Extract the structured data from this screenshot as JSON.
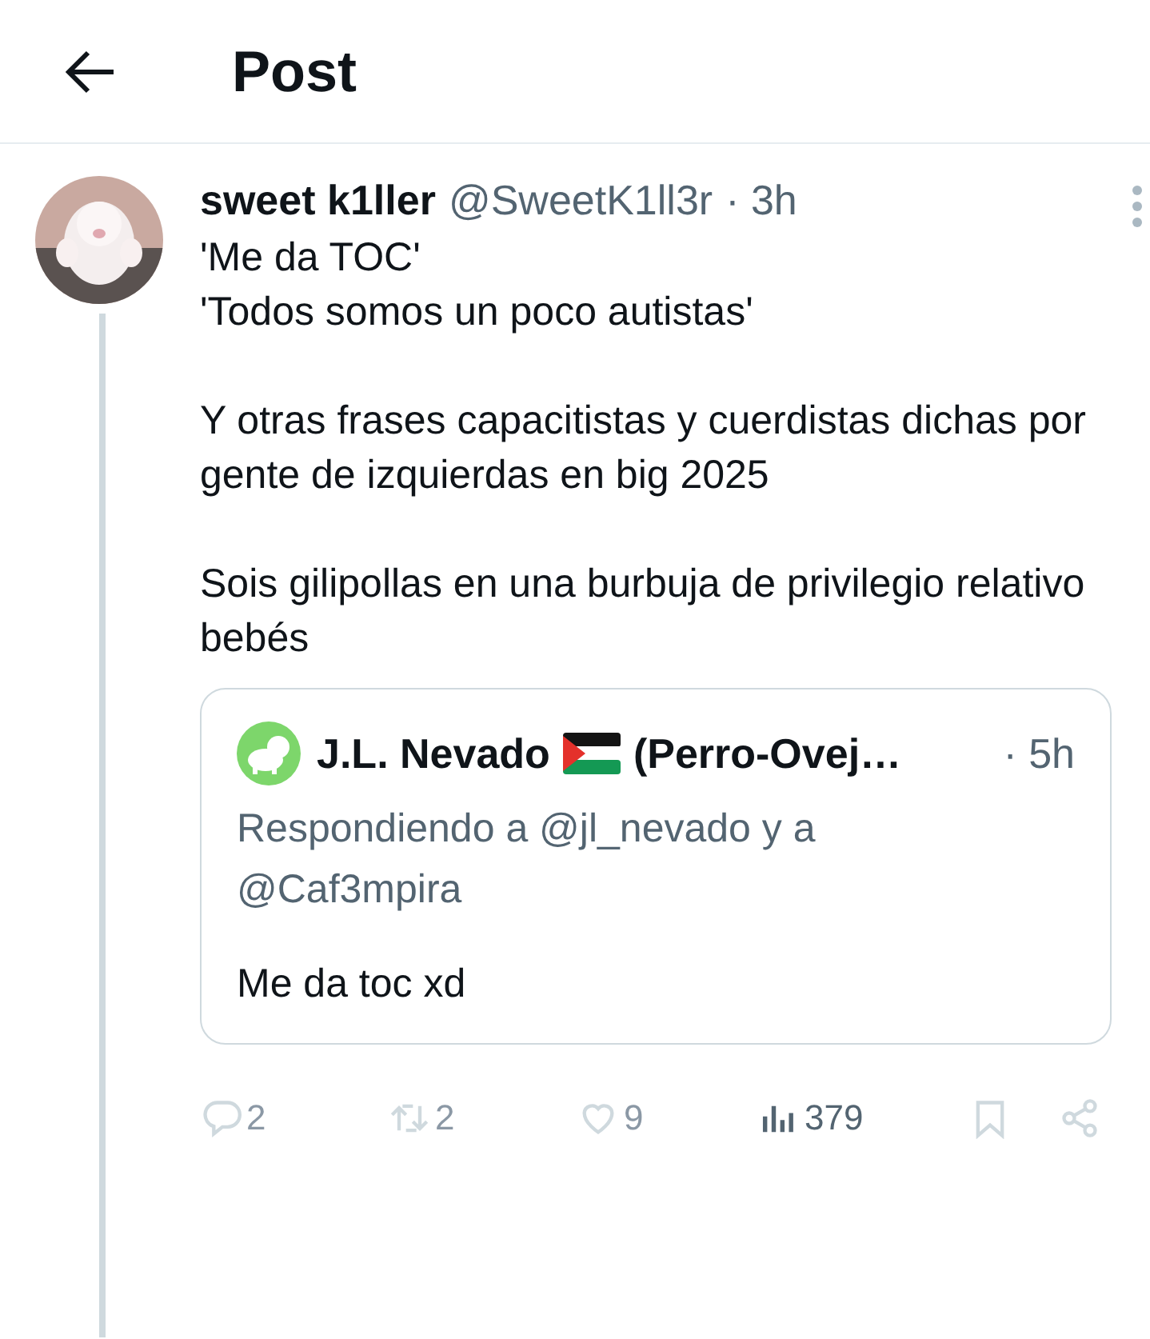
{
  "header": {
    "title": "Post"
  },
  "post": {
    "author_name": "sweet k1ller",
    "handle": "@SweetK1ll3r",
    "time": "· 3h",
    "paragraphs": [
      [
        "'Me da TOC'",
        "'Todos somos un poco autistas'"
      ],
      [
        "Y otras frases capacitistas y cuerdistas dichas por gente de izquierdas en big 2025"
      ],
      [
        "Sois gilipollas en una burbuja de privilegio relativo bebés"
      ]
    ],
    "quote": {
      "author_name": "J.L. Nevado",
      "author_name_suffix": "(Perro-Ovej…",
      "time": "· 5h",
      "replying_to": "Respondiendo a @jl_nevado y a @Caf3mpira",
      "text": "Me da toc xd"
    },
    "actions": [
      {
        "kind": "reply",
        "count": "2",
        "disabled": true
      },
      {
        "kind": "repost",
        "count": "2",
        "disabled": true
      },
      {
        "kind": "like",
        "count": "9",
        "disabled": true
      },
      {
        "kind": "views",
        "count": "379",
        "disabled": false
      },
      {
        "kind": "bookmark",
        "disabled": true
      },
      {
        "kind": "share",
        "disabled": true
      }
    ]
  }
}
